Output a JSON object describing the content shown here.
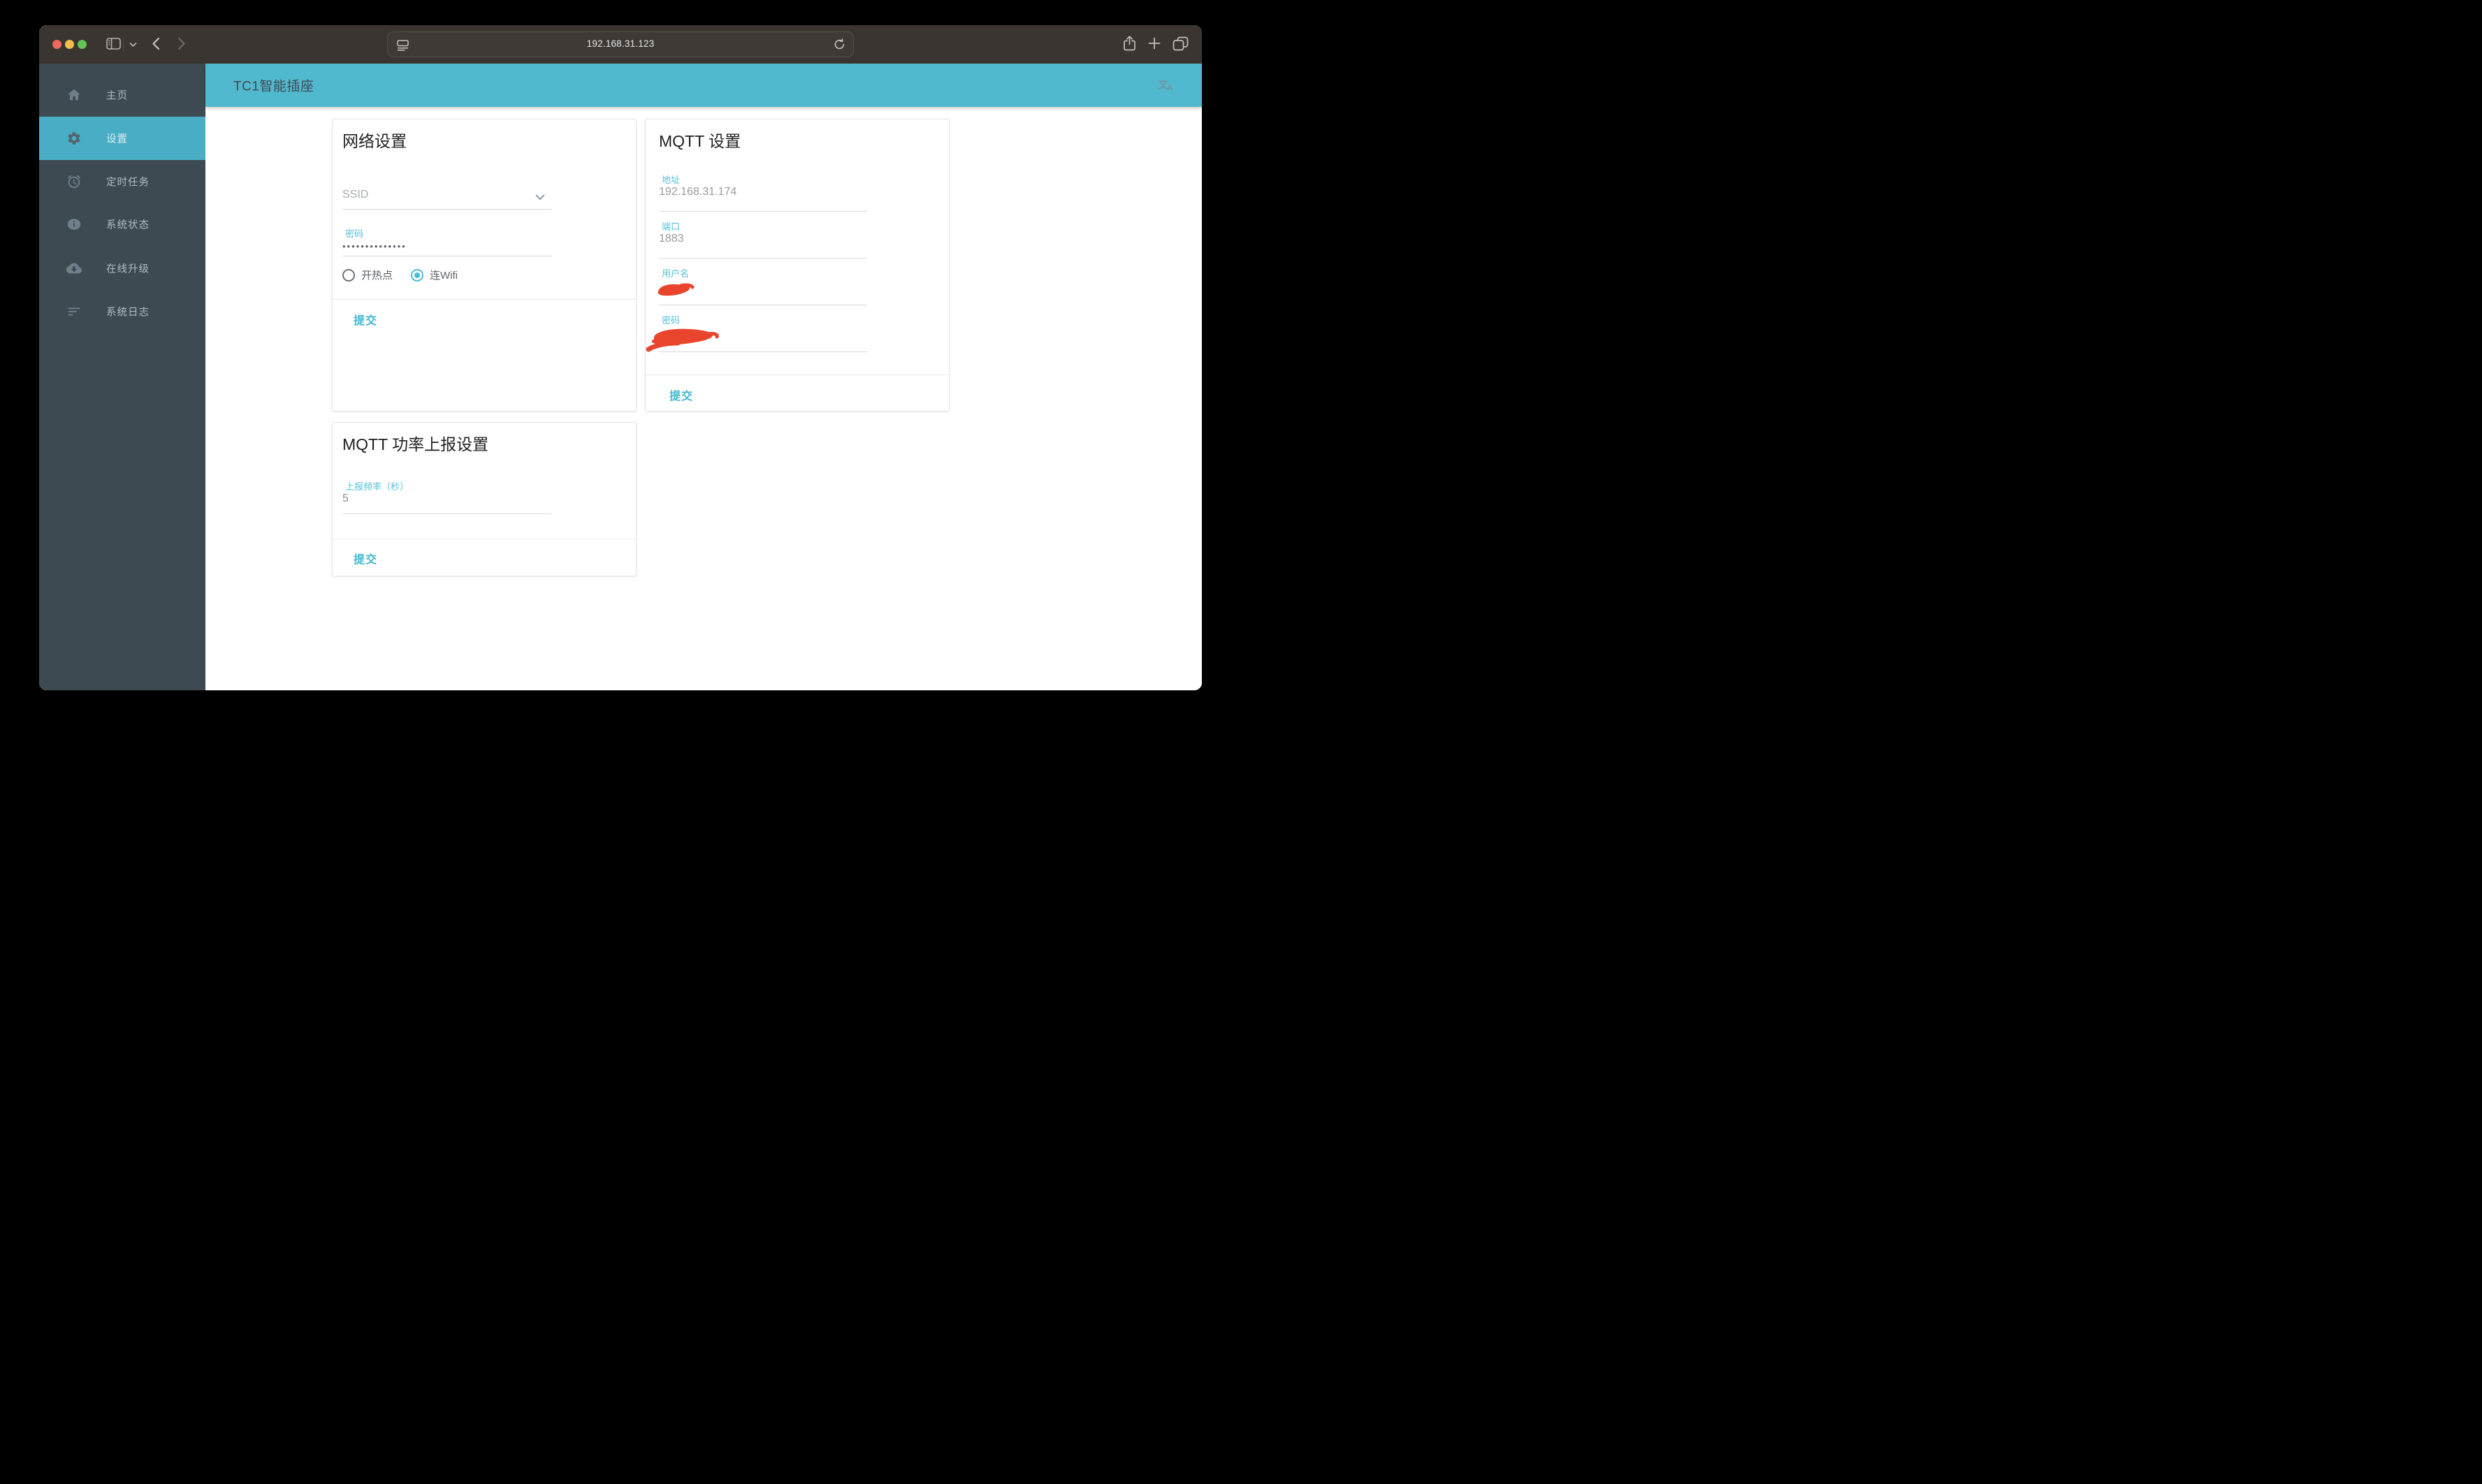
{
  "browser": {
    "url": "192.168.31.123",
    "traffic_lights": [
      "close",
      "minimize",
      "fullscreen"
    ]
  },
  "header": {
    "title": "TC1智能插座",
    "translate_zh": "文",
    "translate_en": "A"
  },
  "sidebar": {
    "items": [
      {
        "label": "主页",
        "icon": "home-icon",
        "active": false
      },
      {
        "label": "设置",
        "icon": "gear-icon",
        "active": true
      },
      {
        "label": "定时任务",
        "icon": "alarm-icon",
        "active": false
      },
      {
        "label": "系统状态",
        "icon": "info-icon",
        "active": false
      },
      {
        "label": "在线升级",
        "icon": "cloud-download-icon",
        "active": false
      },
      {
        "label": "系统日志",
        "icon": "logs-icon",
        "active": false
      }
    ]
  },
  "cards": {
    "network": {
      "title": "网络设置",
      "ssid_placeholder": "SSID",
      "password_label": "密码",
      "password_masked": "••••••••••••••",
      "radio_hotspot": "开热点",
      "radio_wifi": "连Wifi",
      "radio_selected": "连Wifi",
      "submit_label": "提交"
    },
    "mqtt": {
      "title": "MQTT 设置",
      "address_label": "地址",
      "address_value": "192.168.31.174",
      "port_label": "端口",
      "port_value": "1883",
      "username_label": "用户名",
      "username_value_redacted": true,
      "password_label": "密码",
      "password_value_redacted": true,
      "submit_label": "提交"
    },
    "power": {
      "title": "MQTT 功率上报设置",
      "frequency_label": "上报频率（秒）",
      "frequency_value": "5",
      "submit_label": "提交"
    }
  },
  "colors": {
    "header_teal": "#51b9ce",
    "sidebar_bg": "#3d4a52",
    "sidebar_active": "#49aec5",
    "accent_label": "#55c1da",
    "submit_teal": "#43b7d3",
    "redaction_red": "#e8452c",
    "toolbar_bg": "#3a3531"
  }
}
